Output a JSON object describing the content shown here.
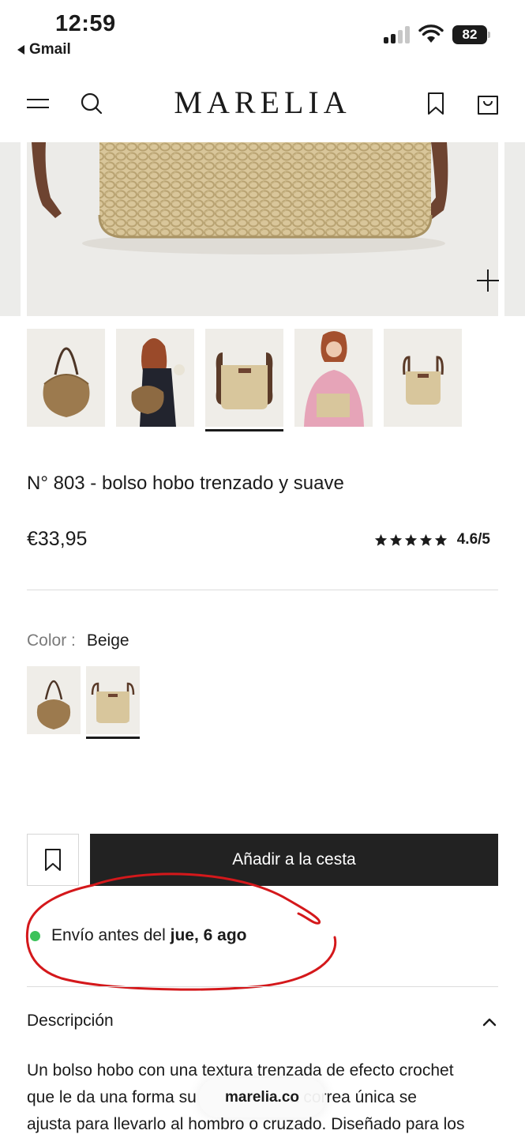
{
  "status_bar": {
    "time": "12:59",
    "back_app": "Gmail",
    "battery": "82"
  },
  "header": {
    "logo": "MARELIA",
    "icons": [
      "menu-icon",
      "search-icon",
      "bookmark-icon",
      "shopping-bag-icon"
    ]
  },
  "product": {
    "title": "N° 803 - bolso hobo trenzado y suave",
    "price": "€33,95",
    "rating": {
      "stars": 5,
      "value": "4.6/5"
    },
    "thumbnails_count": 5,
    "selected_thumbnail": 3
  },
  "color": {
    "label": "Color :",
    "value": "Beige",
    "selected_swatch": 2
  },
  "actions": {
    "add_to_cart": "Añadir a la cesta"
  },
  "shipping": {
    "prefix": "Envío antes del",
    "date": "jue, 6 ago",
    "status_color": "#3cc25a"
  },
  "annotation": {
    "color": "#d4181b"
  },
  "description": {
    "title": "Descripción",
    "line1": "Un bolso hobo con una textura trenzada de efecto crochet",
    "line2_a": "que le da una forma su",
    "line2_b": "a correa única se",
    "line3": "ajusta para llevarlo al hombro o cruzado. Diseñado para los"
  },
  "browser": {
    "url": "marelia.co"
  },
  "colors": {
    "accent_dark": "#222222",
    "annotation_red": "#d4181b",
    "status_green": "#3cc25a"
  }
}
